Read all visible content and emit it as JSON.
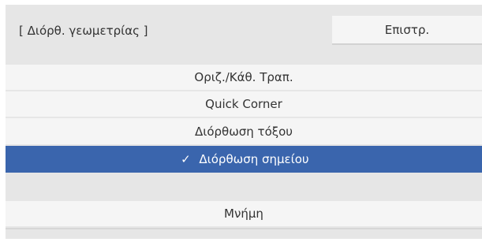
{
  "header": {
    "title": "[ Διόρθ. γεωμετρίας ]",
    "back_label": "Επιστρ."
  },
  "menu": {
    "items": [
      {
        "label": "Οριζ./Κάθ. Τραπ.",
        "selected": false
      },
      {
        "label": "Quick Corner",
        "selected": false
      },
      {
        "label": "Διόρθωση τόξου",
        "selected": false
      },
      {
        "label": "Διόρθωση σημείου",
        "selected": true,
        "check": "✓"
      }
    ],
    "memory_label": "Μνήμη"
  },
  "colors": {
    "selected_bg": "#3a65ad",
    "item_bg": "#f5f5f5",
    "panel_bg": "#e6e6e6"
  }
}
